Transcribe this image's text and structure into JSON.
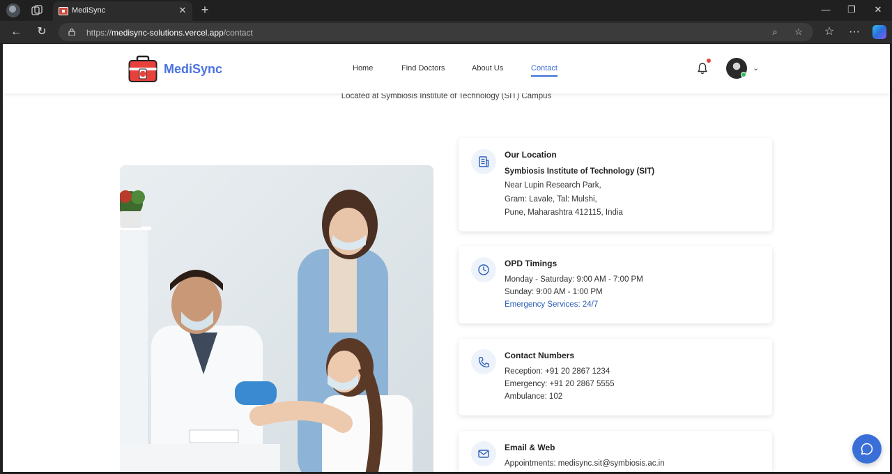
{
  "browser": {
    "tab_title": "MediSync",
    "url_prefix": "https://",
    "url_host": "medisync-solutions.vercel.app",
    "url_path": "/contact"
  },
  "nav": {
    "brand": "MediSync",
    "links": [
      "Home",
      "Find Doctors",
      "About Us",
      "Contact"
    ],
    "active": "Contact"
  },
  "subheading": "Located at Symbiosis Institute of Technology (SIT) Campus",
  "cards": {
    "location": {
      "title": "Our Location",
      "name": "Symbiosis Institute of Technology (SIT)",
      "line1": "Near Lupin Research Park,",
      "line2": "Gram: Lavale, Tal: Mulshi,",
      "line3": "Pune, Maharashtra 412115, India"
    },
    "opd": {
      "title": "OPD Timings",
      "line1": "Monday - Saturday: 9:00 AM - 7:00 PM",
      "line2": "Sunday: 9:00 AM - 1:00 PM",
      "emergency": "Emergency Services: 24/7"
    },
    "contact": {
      "title": "Contact Numbers",
      "reception": "Reception: +91 20 2867 1234",
      "emergency": "Emergency: +91 20 2867 5555",
      "ambulance": "Ambulance: 102"
    },
    "email": {
      "title": "Email & Web",
      "appointments": "Appointments: medisync.sit@symbiosis.ac.in"
    }
  },
  "colors": {
    "accent": "#3b6fd4",
    "brand": "#4a73e0",
    "notification_dot": "#e0463a",
    "online": "#2bbf5a"
  }
}
